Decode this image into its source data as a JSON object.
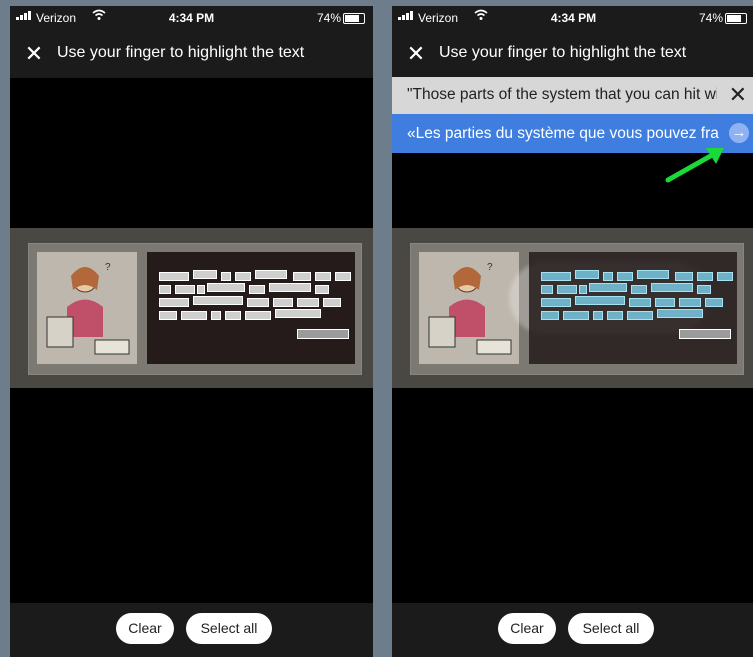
{
  "status": {
    "carrier": "Verizon",
    "time": "4:34 PM",
    "battery": "74%"
  },
  "header": {
    "title": "Use your finger to highlight the text",
    "close_glyph": "✕"
  },
  "actions": {
    "clear_label": "Clear",
    "select_all_label": "Select all"
  },
  "translation": {
    "source_text": "\"Those parts of the system that you can hit with a hammer are called hardware.",
    "translated_text": "«Les parties du système que vous pouvez frapper avec un marteau",
    "close_glyph": "✕",
    "go_glyph": "→"
  },
  "colors": {
    "accent_blue": "#3f7ede",
    "arrow_green": "#19d93b"
  },
  "icons": [
    "signal-icon",
    "wifi-icon",
    "alarm-icon",
    "battery-icon",
    "close-icon",
    "arrow-right-icon",
    "green-arrow-annotation"
  ]
}
